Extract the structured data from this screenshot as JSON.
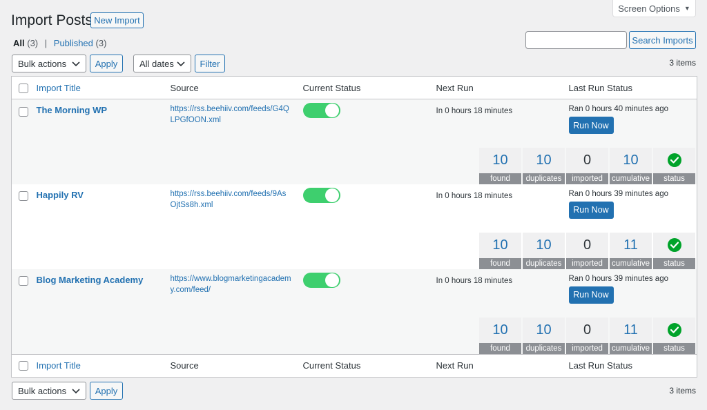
{
  "header": {
    "title": "Import Posts",
    "new_import": "New Import",
    "screen_options": "Screen Options"
  },
  "filters": {
    "all_label": "All",
    "all_count": "(3)",
    "published_label": "Published",
    "published_count": "(3)",
    "separator": "|"
  },
  "search": {
    "button": "Search Imports",
    "value": ""
  },
  "bulk": {
    "label": "Bulk actions",
    "apply": "Apply"
  },
  "dates": {
    "label": "All dates",
    "filter": "Filter"
  },
  "items_count": "3 items",
  "columns": {
    "title": "Import Title",
    "source": "Source",
    "status": "Current Status",
    "next_run": "Next Run",
    "last_run": "Last Run Status"
  },
  "stat_labels": [
    "found",
    "duplicates",
    "imported",
    "cumulative",
    "status"
  ],
  "run_now_label": "Run Now",
  "rows": [
    {
      "title": "The Morning WP",
      "source": "https://rss.beehiiv.com/feeds/G4QLPGfOON.xml",
      "enabled": true,
      "next_run": "In 0 hours 18 minutes",
      "last_run": "Ran 0 hours 40 minutes ago",
      "found": "10",
      "duplicates": "10",
      "imported": "0",
      "cumulative": "10"
    },
    {
      "title": "Happily RV",
      "source": "https://rss.beehiiv.com/feeds/9AsOjtSs8h.xml",
      "enabled": true,
      "next_run": "In 0 hours 18 minutes",
      "last_run": "Ran 0 hours 39 minutes ago",
      "found": "10",
      "duplicates": "10",
      "imported": "0",
      "cumulative": "11"
    },
    {
      "title": "Blog Marketing Academy",
      "source": "https://www.blogmarketingacademy.com/feed/",
      "enabled": true,
      "next_run": "In 0 hours 18 minutes",
      "last_run": "Ran 0 hours 39 minutes ago",
      "found": "10",
      "duplicates": "10",
      "imported": "0",
      "cumulative": "11"
    }
  ],
  "colors": {
    "accent": "#2271b1",
    "toggle_on": "#3ecf6e",
    "success": "#00a32a",
    "label_bg": "#8c8f94"
  }
}
